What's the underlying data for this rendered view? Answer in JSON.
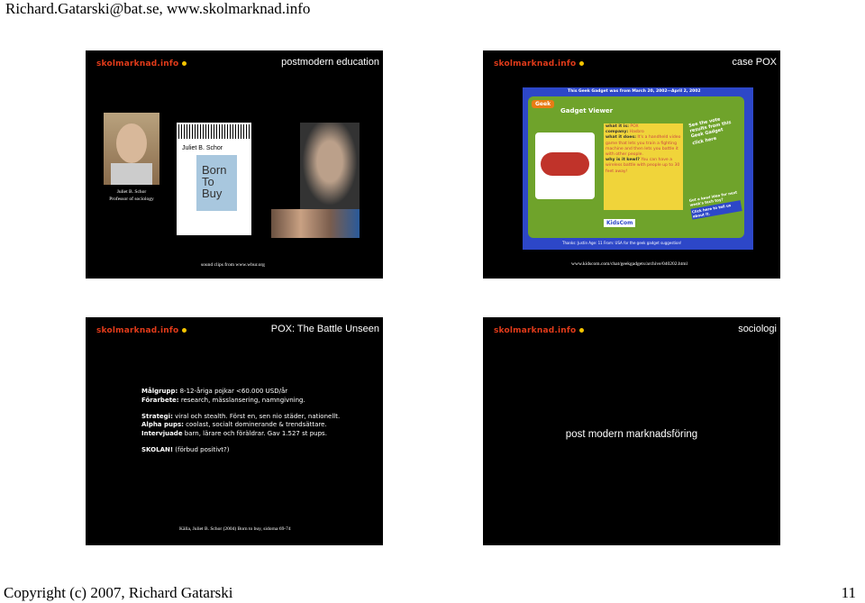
{
  "page": {
    "header": "Richard.Gatarski@bat.se, www.skolmarknad.info",
    "footer_left": "Copyright (c) 2007, Richard Gatarski",
    "footer_right": "11"
  },
  "logo_text": "skolmarknad.info",
  "slide1": {
    "title": "postmodern education",
    "caption_name": "Juliet B. Schor",
    "caption_role": "Professor of sociology",
    "book_author": "Juliet B. Schor",
    "book_title": "Born To Buy",
    "source": "sound clips from www.wbur.org"
  },
  "slide2": {
    "title": "case POX",
    "header_line": "This Geek Gadget was from March 20, 2002—April 2, 2002",
    "geek": "Geek",
    "gadget_viewer": "Gadget Viewer",
    "what_label": "what it is:",
    "what_value": "POX",
    "company_label": "company:",
    "company_value": "Hasbro",
    "does_label": "what it does:",
    "does_value": "It's a handheld video game that lets you train a fighting machine and then lets you battle it with other people.",
    "kewl_label": "why is it kewl?",
    "kewl_value": "You can have a wireless battle with people up to 30 feet away!",
    "vote": "See the vote results from this Geek Gadget",
    "click_here": "click here",
    "idea": "Got a kewl idea for next week's tech toy?",
    "click_tell": "Click here to tell us about it.",
    "thanks": "Thanks: Justin Age: 11 From: USA for the geek gadget suggestion!",
    "kidscom": "KidsCom",
    "source": "www.kidscom.com/chat/geekgadgets/archive/040202.html"
  },
  "slide3": {
    "title": "POX: The Battle Unseen",
    "l1_label": "Målgrupp:",
    "l1_value": " 8-12-åriga pojkar <60.000 USD/år",
    "l2_label": "Förarbete:",
    "l2_value": " research, mässlansering, namngivning.",
    "l3_label": "Strategi:",
    "l3_value": " viral och stealth. Först en, sen nio städer, nationellt.",
    "l4_label": "Alpha pups:",
    "l4_value": " coolast, socialt dominerande & trendsättare.",
    "l5_label": "Intervjuade",
    "l5_value": " barn, lärare och föräldrar. Gav 1.527 st pups.",
    "l6_label": "SKOLAN!",
    "l6_value": " (förbud positivt?)",
    "source": "Källa, Juliet B. Schor (2004) Born to buy, sidorna 69-74"
  },
  "slide4": {
    "title": "sociologi",
    "body": "post modern marknadsföring"
  },
  "colors": {
    "slide_bg": "#000000",
    "logo_red": "#e23b1a",
    "kidscom_blue": "#2d47c8",
    "kidscom_green": "#6fa32b",
    "kidscom_yellow": "#f0d43a"
  }
}
